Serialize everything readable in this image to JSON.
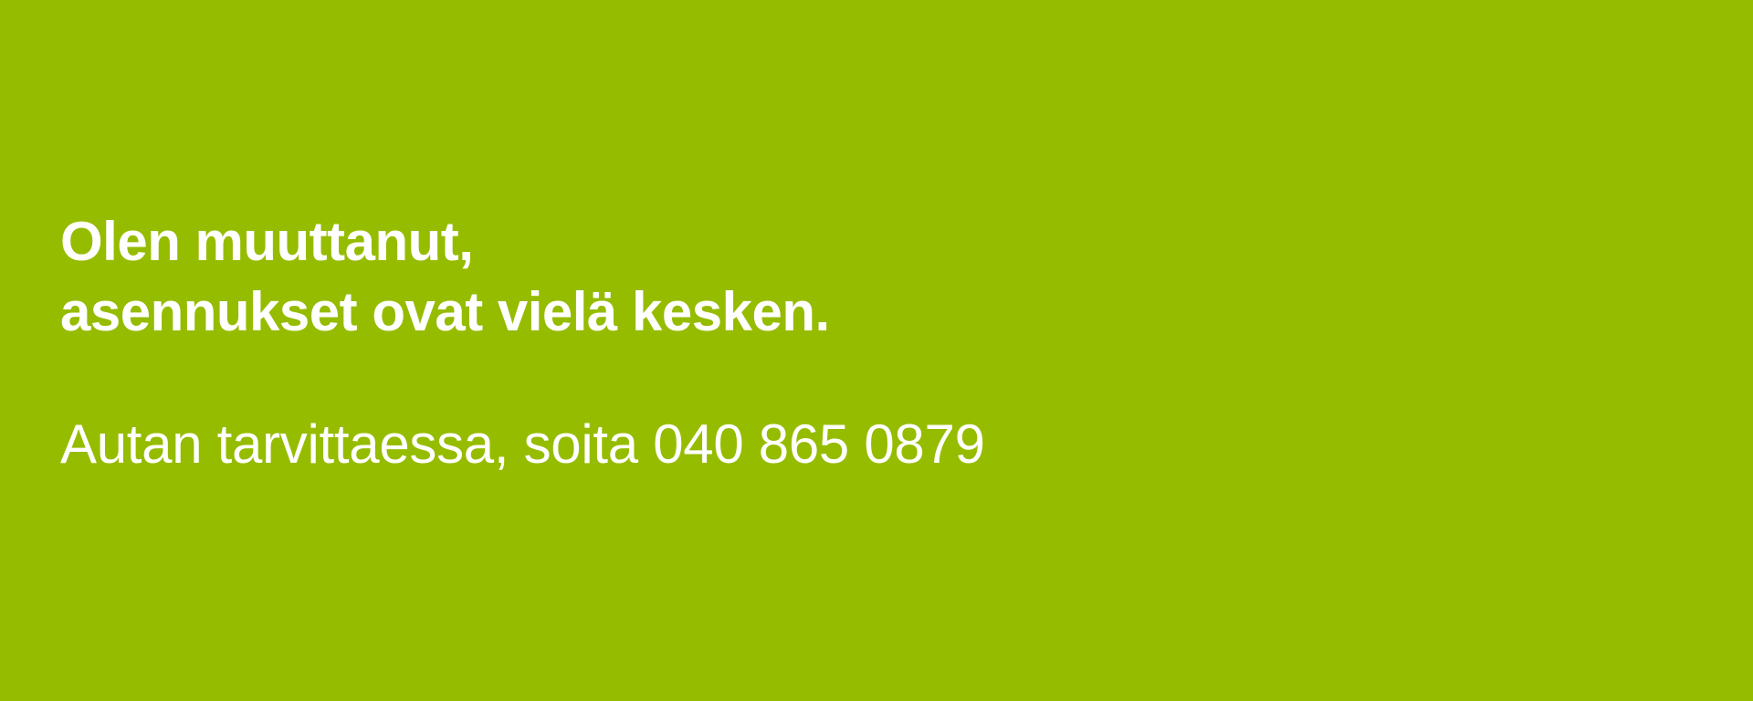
{
  "page": {
    "background_color": "#96bc00",
    "text_color": "#ffffff"
  },
  "notice": {
    "headline_line_1": "Olen muuttanut,",
    "headline_line_2": "asennukset ovat vielä kesken.",
    "contact_text": "Autan tarvittaessa, soita 040 865 0879"
  }
}
